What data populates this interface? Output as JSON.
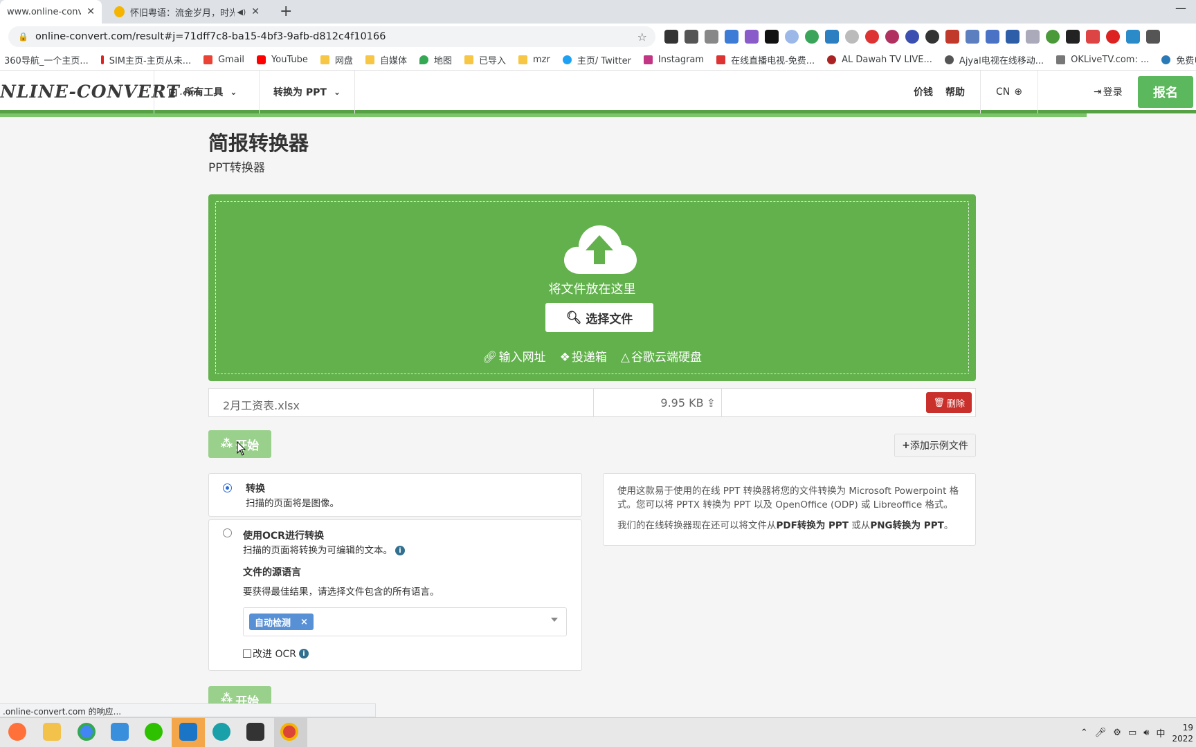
{
  "browser": {
    "tabs": [
      {
        "title": "www.online-convert.cc",
        "active": true
      },
      {
        "title": "怀旧粤语：流金岁月，时光",
        "active": false
      }
    ],
    "url": "online-convert.com/result#j=71dff7c8-ba15-4bf3-9afb-d812c4f10166",
    "bookmarks": [
      "360导航_一个主页...",
      "SIM主页-主页从未...",
      "Gmail",
      "YouTube",
      "网盘",
      "自媒体",
      "地图",
      "已导入",
      "mzr",
      "主页/ Twitter",
      "Instagram",
      "在线直播电视-免费...",
      "AL Dawah TV LIVE...",
      "Ajyal电视在线移动...",
      "OKLiveTV.com: ...",
      "免费电影: Ang"
    ],
    "status_text": ".online-convert.com 的响应..."
  },
  "site": {
    "logo": "NLINE-CONVERT",
    "logo_suffix": ".com",
    "nav": {
      "all_tools": "所有工具",
      "convert_to": "转换为 PPT",
      "pricing": "价钱",
      "help": "帮助",
      "lang": "CN",
      "login": "登录",
      "signup": "报名"
    }
  },
  "page": {
    "title": "简报转换器",
    "subtitle": "PPT转换器",
    "dropzone": {
      "drop_text": "将文件放在这里",
      "choose_label": "选择文件",
      "links": [
        "输入网址",
        "投递箱",
        "谷歌云端硬盘"
      ]
    },
    "file": {
      "name": "2月工资表.xlsx",
      "size": "9.95 KB",
      "delete_label": "删除"
    },
    "start_label": "开始",
    "add_example_label": "添加示例文件",
    "options": {
      "convert": {
        "title": "转换",
        "desc": "扫描的页面将是图像。",
        "selected": true
      },
      "ocr": {
        "title": "使用OCR进行转换",
        "desc": "扫描的页面将转换为可编辑的文本。",
        "source_lang_title": "文件的源语言",
        "source_lang_desc": "要获得最佳结果，请选择文件包含的所有语言。",
        "selected_lang": "自动检测",
        "improve_label": "改进 OCR"
      }
    },
    "info": {
      "p1": "使用这款易于使用的在线 PPT 转换器将您的文件转换为 Microsoft Powerpoint 格式。您可以将 PPTX 转换为 PPT 以及 OpenOffice (ODP) 或 Libreoffice 格式。",
      "p2_a": "我们的在线转换器现在还可以将文件从",
      "p2_b": "PDF转换为 PPT",
      "p2_c": " 或从",
      "p2_d": "PNG转换为 PPT",
      "p2_e": "。"
    }
  },
  "taskbar": {
    "ime": "中",
    "time": "19",
    "date": "2022"
  },
  "colors": {
    "brand_green": "#62b14c",
    "signup_green": "#5cb85c",
    "delete_red": "#c9302c",
    "chip_blue": "#5890d6"
  }
}
